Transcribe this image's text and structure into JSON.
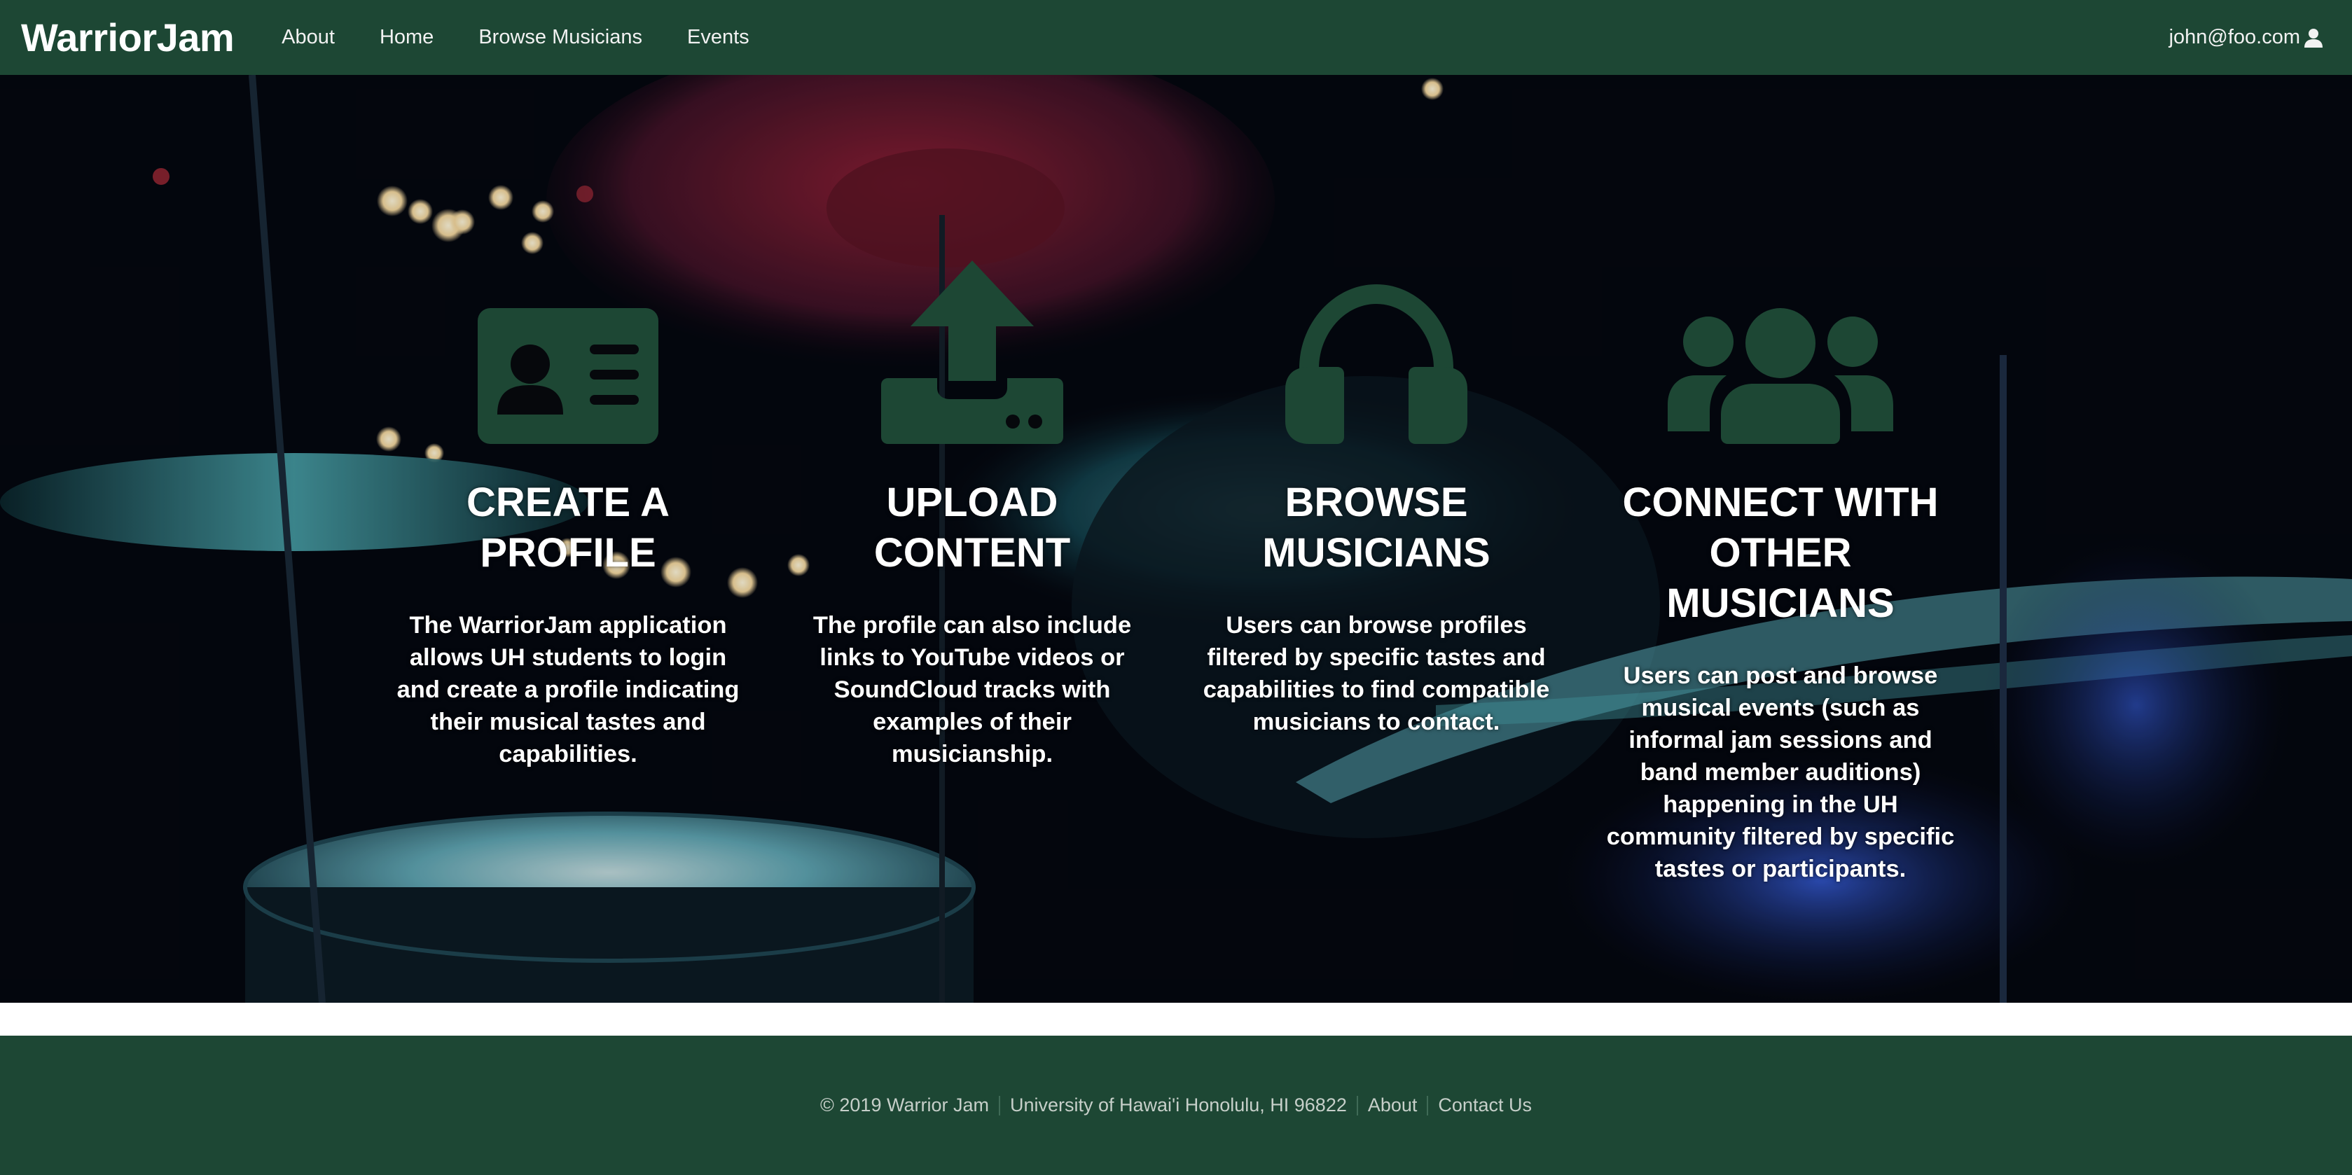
{
  "navbar": {
    "brand": "WarriorJam",
    "links": [
      "About",
      "Home",
      "Browse Musicians",
      "Events"
    ],
    "user_email": "john@foo.com"
  },
  "features": [
    {
      "icon": "id-card-icon",
      "title": "CREATE A PROFILE",
      "text": "The WarriorJam application allows UH students to login and create a profile indicating their musical tastes and capabilities."
    },
    {
      "icon": "upload-icon",
      "title": "UPLOAD CONTENT",
      "text": "The profile can also include links to YouTube videos or SoundCloud tracks with examples of their musicianship."
    },
    {
      "icon": "headphones-icon",
      "title": "BROWSE MUSICIANS",
      "text": "Users can browse profiles filtered by specific tastes and capabilities to find compatible musicians to contact."
    },
    {
      "icon": "users-icon",
      "title": "CONNECT WITH OTHER MUSICIANS",
      "text": "Users can post and browse musical events (such as informal jam sessions and band member auditions) happening in the UH community filtered by specific tastes or participants."
    }
  ],
  "footer": {
    "copyright": "© 2019 Warrior Jam",
    "address": "University of Hawai'i Honolulu, HI 96822",
    "about": "About",
    "contact": "Contact Us"
  },
  "colors": {
    "brand_green": "#1d4734",
    "icon_green": "#1d4734",
    "footer_text": "#c6cfc9"
  }
}
